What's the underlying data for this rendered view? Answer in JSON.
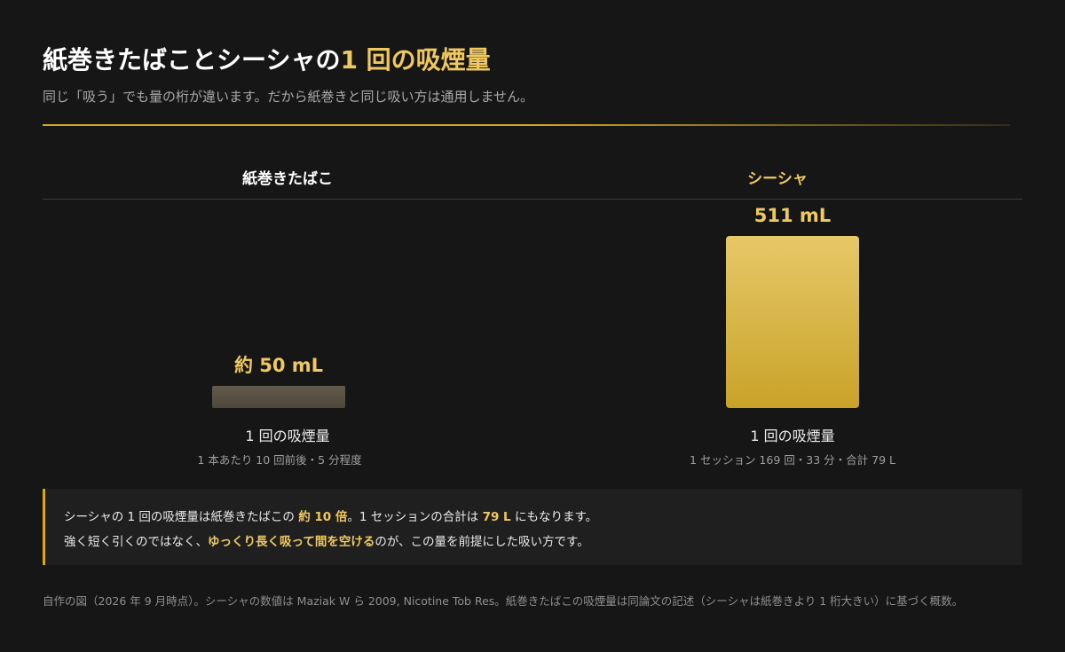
{
  "header": {
    "title_main": "紙巻きたばことシーシャの",
    "title_accent": "1 回の吸煙量",
    "subtitle": "同じ「吸う」でも量の桁が違います。だから紙巻きと同じ吸い方は通用しません。"
  },
  "columns": [
    {
      "heading": "紙巻きたばこ",
      "note": "1 回の吸煙量",
      "detail": "1 本あたり 10 回前後・5 分程度"
    },
    {
      "heading": "シーシャ",
      "note": "1 回の吸煙量",
      "detail": "1 セッション 169 回・33 分・合計 79 L"
    }
  ],
  "chart_data": {
    "type": "bar",
    "categories": [
      "紙巻きたばこ",
      "シーシャ"
    ],
    "values": [
      50,
      511
    ],
    "value_labels": [
      "約 50 mL",
      "511 mL"
    ],
    "unit": "mL",
    "ylim": [
      0,
      511
    ],
    "colors": [
      "#5a5245",
      "#d9b23a"
    ]
  },
  "callout": {
    "line1_a": "シーシャの 1 回の吸煙量は紙巻きたばこの ",
    "line1_hl1": "約 10 倍",
    "line1_b": "。1 セッションの合計は ",
    "line1_hl2": "79 L",
    "line1_c": " にもなります。",
    "line2_a": "強く短く引くのではなく、",
    "line2_hl": "ゆっくり長く吸って間を空ける",
    "line2_b": "のが、この量を前提にした吸い方です。"
  },
  "footer": "自作の図（2026 年 9 月時点）。シーシャの数値は Maziak W ら 2009, Nicotine Tob Res。紙巻きたばこの吸煙量は同論文の記述（シーシャは紙巻きより 1 桁大きい）に基づく概数。",
  "colors": {
    "background": "#161616",
    "accent": "#f0c95e",
    "bar_shisha": "#d9b23a",
    "bar_cigarette": "#5a5245"
  }
}
